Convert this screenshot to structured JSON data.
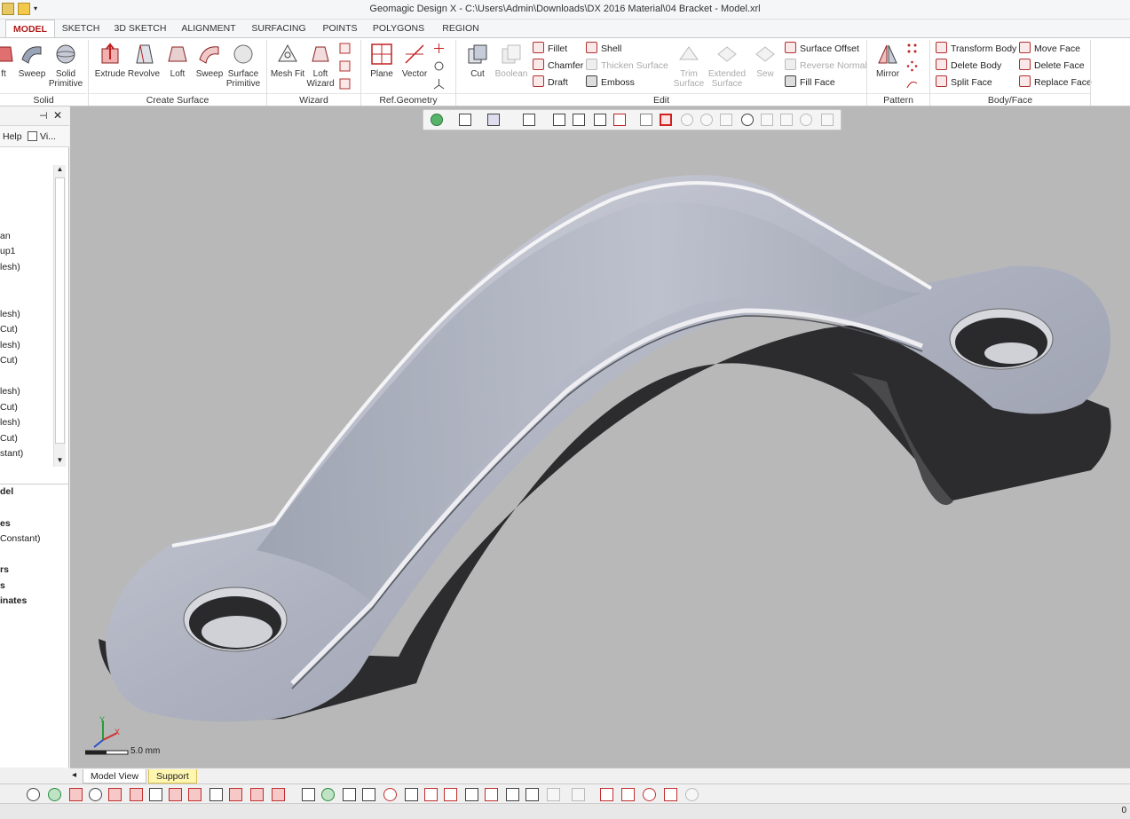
{
  "window": {
    "title": "Geomagic Design X - C:\\Users\\Admin\\Downloads\\DX 2016 Material\\04 Bracket - Model.xrl"
  },
  "tabs": [
    "MODEL",
    "SKETCH",
    "3D SKETCH",
    "ALIGNMENT",
    "SURFACING",
    "POINTS",
    "POLYGONS",
    "REGION"
  ],
  "ribbon": {
    "solid": {
      "label": "Solid",
      "buttons": [
        "ft",
        "Sweep",
        "Solid Primitive"
      ]
    },
    "create_surface": {
      "label": "Create Surface",
      "buttons": [
        "Extrude",
        "Revolve",
        "Loft",
        "Sweep",
        "Surface Primitive"
      ]
    },
    "wizard": {
      "label": "Wizard",
      "buttons": [
        "Mesh Fit",
        "Loft Wizard"
      ]
    },
    "ref_geometry": {
      "label": "Ref.Geometry",
      "buttons": [
        "Plane",
        "Vector"
      ]
    },
    "edit": {
      "label": "Edit",
      "big": [
        "Cut",
        "Boolean",
        "Trim Surface",
        "Extended Surface",
        "Sew"
      ],
      "small": [
        "Fillet",
        "Chamfer",
        "Draft",
        "Shell",
        "Thicken Surface",
        "Emboss",
        "Surface Offset",
        "Reverse Normal",
        "Fill Face"
      ]
    },
    "pattern": {
      "label": "Pattern",
      "buttons": [
        "Mirror"
      ]
    },
    "body_face": {
      "label": "Body/Face",
      "buttons": [
        "Transform Body",
        "Delete Body",
        "Split Face",
        "Move Face",
        "Delete Face",
        "Replace Face"
      ]
    }
  },
  "left_panel": {
    "menu": [
      "Help",
      "Vi..."
    ],
    "tree": [
      "an",
      "up1",
      "lesh)",
      "lesh)",
      "Cut)",
      "lesh)",
      "Cut)",
      "lesh)",
      "Cut)",
      "lesh)",
      "Cut)",
      "stant)"
    ],
    "lower": [
      "del",
      "es",
      "Constant)",
      "rs",
      "s",
      "inates"
    ]
  },
  "viewport": {
    "scale": "5.0 mm",
    "axis_x": "X",
    "axis_y": "Y"
  },
  "bottom_tabs": [
    "Model View",
    "Support"
  ],
  "status": {
    "right": "0"
  }
}
